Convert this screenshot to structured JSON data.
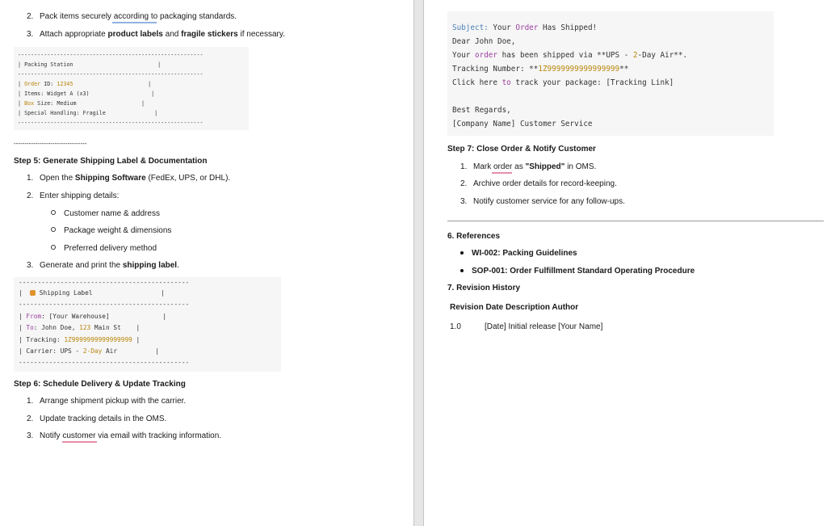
{
  "left": {
    "list_top": [
      {
        "num": "2.",
        "pre": "Pack items securely ",
        "mid": "according to",
        "post": " packaging standards."
      },
      {
        "num": "3.",
        "pre": "Attach appropriate ",
        "b1": "product labels",
        "mid": " and ",
        "b2": "fragile stickers",
        "post": " if necessary."
      }
    ],
    "packing_station": {
      "dash": "---------------------------------------------------------",
      "title": "Packing Station",
      "order_key": "Order",
      "order_val": " ID: ",
      "order_id": "12345",
      "items": "Items: Widget A (x3)",
      "box_key": "Box",
      "box_val": " Size: Medium",
      "special": "Special Handling: Fragile"
    },
    "separator": "----------------------------------",
    "step5": {
      "heading": "Step 5: Generate Shipping Label & Documentation",
      "item1_pre": "Open the ",
      "item1_b": "Shipping Software",
      "item1_post": " (FedEx, UPS, or DHL).",
      "item2": "Enter shipping details:",
      "sub": [
        "Customer name & address",
        "Package weight & dimensions",
        "Preferred delivery method"
      ],
      "item3_pre": "Generate and print the ",
      "item3_b": "shipping label",
      "item3_post": "."
    },
    "shipping_label": {
      "dash": "---------------------------------------------",
      "title": "Shipping Label",
      "from_key": "From",
      "from_val": ": [Your Warehouse]",
      "to_key": "To",
      "to_val": ": John Doe, ",
      "to_num": "123",
      "to_rest": " Main St",
      "tracking_key": "Tracking: ",
      "tracking_val": "1Z9999999999999999",
      "carrier_pre": "Carrier: UPS - ",
      "carrier_num": "2",
      "carrier_day": "-Day",
      "carrier_post": " Air"
    },
    "step6": {
      "heading": "Step 6: Schedule Delivery & Update Tracking",
      "items": [
        {
          "num": "1.",
          "text": "Arrange shipment pickup with the carrier."
        },
        {
          "num": "2.",
          "text": "Update tracking details in the OMS."
        }
      ],
      "item3_num": "3.",
      "item3_pre": "Notify ",
      "item3_mid": "customer",
      "item3_post": " via email with tracking information."
    }
  },
  "right": {
    "email": {
      "subject_key": "Subject:",
      "subject_pre": " Your ",
      "subject_order": "Order",
      "subject_post": " Has Shipped!",
      "greeting": "Dear John Doe,",
      "line2_pre": "Your ",
      "line2_order": "order",
      "line2_mid": " has been shipped via **UPS - ",
      "line2_num": "2",
      "line2_post": "-Day Air**.",
      "line3_pre": "Tracking Number: **",
      "line3_num": "1Z9999999999999999",
      "line3_post": "**",
      "line4_pre": "Click here ",
      "line4_to": "to",
      "line4_post": " track your package: [Tracking Link]",
      "regards": "Best Regards,",
      "signature": "[Company Name] Customer Service"
    },
    "step7": {
      "heading": "Step 7: Close Order & Notify Customer",
      "item1_num": "1.",
      "item1_pre": "Mark ",
      "item1_mid": "order",
      "item1_post": " as ",
      "item1_b": "\"Shipped\"",
      "item1_end": " in OMS.",
      "items": [
        {
          "num": "2.",
          "text": "Archive order details for record-keeping."
        },
        {
          "num": "3.",
          "text": "Notify customer service for any follow-ups."
        }
      ]
    },
    "references": {
      "heading": "6. References",
      "items": [
        "WI-002: Packing Guidelines",
        "SOP-001: Order Fulfillment Standard Operating Procedure"
      ]
    },
    "revision": {
      "heading": "7. Revision History",
      "headers": [
        "Revision",
        "Date",
        "Description",
        "Author"
      ],
      "row": {
        "revision": "1.0",
        "rest": "[Date] Initial release [Your Name]"
      }
    }
  }
}
